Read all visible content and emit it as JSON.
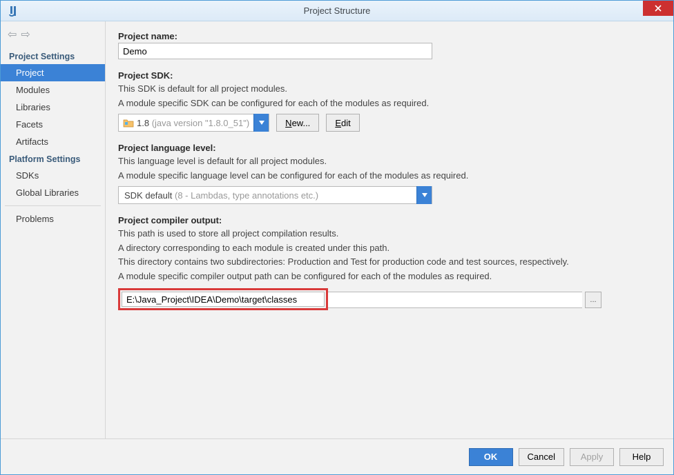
{
  "window": {
    "title": "Project Structure"
  },
  "sidebar": {
    "sections": {
      "project_settings_header": "Project Settings",
      "platform_settings_header": "Platform Settings"
    },
    "items": {
      "project": "Project",
      "modules": "Modules",
      "libraries": "Libraries",
      "facets": "Facets",
      "artifacts": "Artifacts",
      "sdks": "SDKs",
      "global_libraries": "Global Libraries",
      "problems": "Problems"
    }
  },
  "main": {
    "project_name_label": "Project name:",
    "project_name_value": "Demo",
    "project_sdk_label": "Project SDK:",
    "project_sdk_help1": "This SDK is default for all project modules.",
    "project_sdk_help2": "A module specific SDK can be configured for each of the modules as required.",
    "sdk_combo_main": "1.8",
    "sdk_combo_gray": " (java version \"1.8.0_51\")",
    "new_btn_prefix": "N",
    "new_btn_rest": "ew...",
    "edit_btn_prefix": "E",
    "edit_btn_rest": "dit",
    "lang_level_label": "Project language level:",
    "lang_level_help1": "This language level is default for all project modules.",
    "lang_level_help2": "A module specific language level can be configured for each of the modules as required.",
    "lang_combo_main": "SDK default",
    "lang_combo_gray": " (8 - Lambdas, type annotations etc.)",
    "compiler_output_label": "Project compiler output:",
    "compiler_output_help1": "This path is used to store all project compilation results.",
    "compiler_output_help2": "A directory corresponding to each module is created under this path.",
    "compiler_output_help3": "This directory contains two subdirectories: Production and Test for production code and test sources, respectively.",
    "compiler_output_help4": "A module specific compiler output path can be configured for each of the modules as required.",
    "compiler_output_value": "E:\\Java_Project\\IDEA\\Demo\\target\\classes",
    "browse_label": "..."
  },
  "buttons": {
    "ok": "OK",
    "cancel": "Cancel",
    "apply": "Apply",
    "help": "Help"
  }
}
